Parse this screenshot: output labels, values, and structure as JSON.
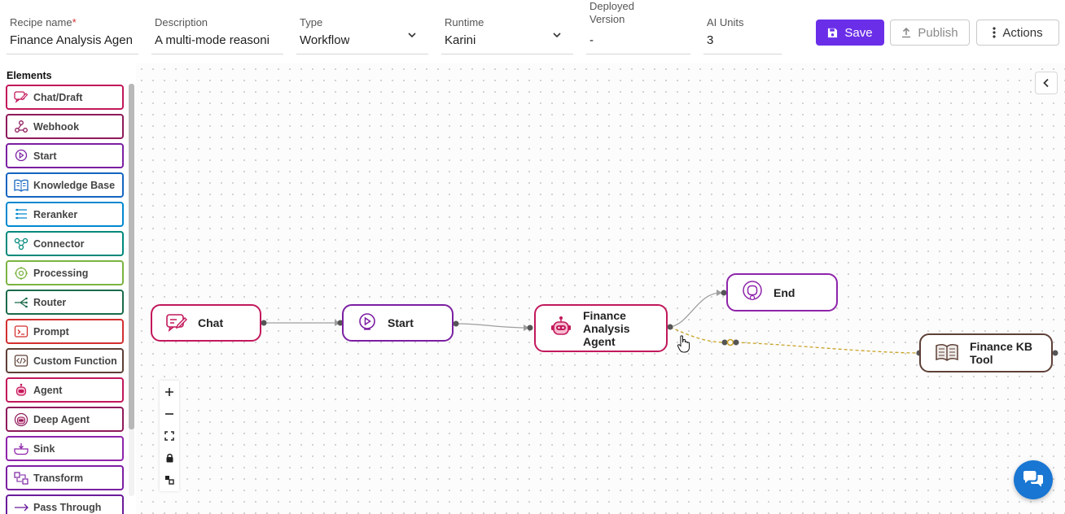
{
  "header": {
    "recipe_name": {
      "label": "Recipe name",
      "required_mark": "*",
      "value": "Finance Analysis Agen"
    },
    "description": {
      "label": "Description",
      "value": "A multi-mode reasoni"
    },
    "type": {
      "label": "Type",
      "value": "Workflow"
    },
    "runtime": {
      "label": "Runtime",
      "value": "Karini"
    },
    "deployed_version": {
      "label": "Deployed\nVersion",
      "value": "-"
    },
    "ai_units": {
      "label": "AI Units",
      "value": "3"
    },
    "buttons": {
      "save": "Save",
      "publish": "Publish",
      "actions": "Actions"
    }
  },
  "sidebar": {
    "title": "Elements",
    "items": [
      {
        "label": "Chat/Draft",
        "color": "#c2185b",
        "icon": "chat-draft-icon"
      },
      {
        "label": "Webhook",
        "color": "#8e1a5a",
        "icon": "webhook-icon"
      },
      {
        "label": "Start",
        "color": "#7b1fa2",
        "icon": "start-play-icon"
      },
      {
        "label": "Knowledge Base",
        "color": "#1565c0",
        "icon": "knowledge-base-icon"
      },
      {
        "label": "Reranker",
        "color": "#0288d1",
        "icon": "reranker-icon"
      },
      {
        "label": "Connector",
        "color": "#00897b",
        "icon": "connector-icon"
      },
      {
        "label": "Processing",
        "color": "#7cb342",
        "icon": "processing-icon"
      },
      {
        "label": "Router",
        "color": "#1b6b4a",
        "icon": "router-icon"
      },
      {
        "label": "Prompt",
        "color": "#d32f2f",
        "icon": "prompt-icon"
      },
      {
        "label": "Custom Function",
        "color": "#5d4037",
        "icon": "custom-function-icon"
      },
      {
        "label": "Agent",
        "color": "#c2185b",
        "icon": "agent-robot-icon"
      },
      {
        "label": "Deep Agent",
        "color": "#8e1a5a",
        "icon": "deep-agent-icon"
      },
      {
        "label": "Sink",
        "color": "#8e24aa",
        "icon": "sink-icon"
      },
      {
        "label": "Transform",
        "color": "#7b1fa2",
        "icon": "transform-icon"
      },
      {
        "label": "Pass Through",
        "color": "#6a1b9a",
        "icon": "pass-through-icon"
      }
    ]
  },
  "canvas": {
    "nodes": {
      "chat": {
        "label": "Chat",
        "color": "#c2185b",
        "icon": "chat-draft-icon"
      },
      "start": {
        "label": "Start",
        "color": "#7b1fa2",
        "icon": "start-play-icon"
      },
      "agent": {
        "label": "Finance\nAnalysis\nAgent",
        "color": "#c2185b",
        "icon": "agent-robot-icon"
      },
      "end": {
        "label": "End",
        "color": "#8e24aa",
        "icon": "end-icon"
      },
      "kb_tool": {
        "label": "Finance KB\nTool",
        "color": "#5d4037",
        "icon": "book-icon"
      }
    },
    "edge_colors": {
      "flow": "#9e9e9e",
      "tool": "#c9a227"
    },
    "zoom_controls": [
      "zoom-in",
      "zoom-out",
      "fit-view",
      "lock",
      "interactive"
    ]
  },
  "colors": {
    "accent": "#6b2ee8",
    "chat_fab": "#1976d2"
  }
}
